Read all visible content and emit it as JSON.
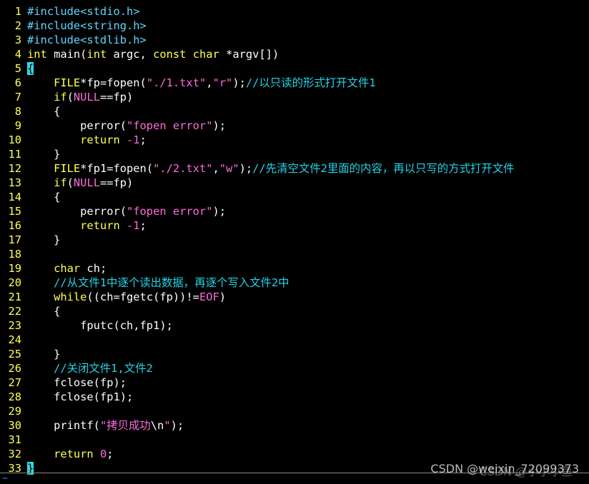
{
  "editor": {
    "lines": [
      {
        "n": "1",
        "parts": [
          [
            "pre",
            "#include<stdio.h>"
          ]
        ]
      },
      {
        "n": "2",
        "parts": [
          [
            "pre",
            "#include<string.h>"
          ]
        ]
      },
      {
        "n": "3",
        "parts": [
          [
            "pre",
            "#include<stdlib.h>"
          ]
        ]
      },
      {
        "n": "4",
        "parts": [
          [
            "kw",
            "int"
          ],
          [
            "code",
            " main("
          ],
          [
            "kw",
            "int"
          ],
          [
            "code",
            " argc, "
          ],
          [
            "kw",
            "const"
          ],
          [
            "code",
            " "
          ],
          [
            "kw",
            "char"
          ],
          [
            "code",
            " *argv[])"
          ]
        ]
      },
      {
        "n": "5",
        "parts": [
          [
            "brace-hl",
            "{"
          ]
        ]
      },
      {
        "n": "6",
        "parts": [
          [
            "code",
            "    "
          ],
          [
            "kw",
            "FILE"
          ],
          [
            "code",
            "*fp=fopen("
          ],
          [
            "str",
            "\"./1.txt\""
          ],
          [
            "code",
            ","
          ],
          [
            "str",
            "\"r\""
          ],
          [
            "code",
            ");"
          ],
          [
            "cmt",
            "//以只读的形式打开文件1"
          ]
        ]
      },
      {
        "n": "7",
        "parts": [
          [
            "code",
            "    "
          ],
          [
            "kw",
            "if"
          ],
          [
            "code",
            "("
          ],
          [
            "num",
            "NULL"
          ],
          [
            "code",
            "==fp)"
          ]
        ]
      },
      {
        "n": "8",
        "parts": [
          [
            "code",
            "    {"
          ]
        ]
      },
      {
        "n": "9",
        "parts": [
          [
            "code",
            "        perror("
          ],
          [
            "str",
            "\"fopen error\""
          ],
          [
            "code",
            ");"
          ]
        ]
      },
      {
        "n": "10",
        "parts": [
          [
            "code",
            "        "
          ],
          [
            "kw",
            "return"
          ],
          [
            "code",
            " "
          ],
          [
            "num",
            "-1"
          ],
          [
            "code",
            ";"
          ]
        ]
      },
      {
        "n": "11",
        "parts": [
          [
            "code",
            "    }"
          ]
        ]
      },
      {
        "n": "12",
        "parts": [
          [
            "code",
            "    "
          ],
          [
            "kw",
            "FILE"
          ],
          [
            "code",
            "*fp1=fopen("
          ],
          [
            "str",
            "\"./2.txt\""
          ],
          [
            "code",
            ","
          ],
          [
            "str",
            "\"w\""
          ],
          [
            "code",
            ");"
          ],
          [
            "cmt",
            "//先清空文件2里面的内容，再以只写的方式打开文件"
          ]
        ]
      },
      {
        "n": "13",
        "parts": [
          [
            "code",
            "    "
          ],
          [
            "kw",
            "if"
          ],
          [
            "code",
            "("
          ],
          [
            "num",
            "NULL"
          ],
          [
            "code",
            "==fp)"
          ]
        ]
      },
      {
        "n": "14",
        "parts": [
          [
            "code",
            "    {"
          ]
        ]
      },
      {
        "n": "15",
        "parts": [
          [
            "code",
            "        perror("
          ],
          [
            "str",
            "\"fopen error\""
          ],
          [
            "code",
            ");"
          ]
        ]
      },
      {
        "n": "16",
        "parts": [
          [
            "code",
            "        "
          ],
          [
            "kw",
            "return"
          ],
          [
            "code",
            " "
          ],
          [
            "num",
            "-1"
          ],
          [
            "code",
            ";"
          ]
        ]
      },
      {
        "n": "17",
        "parts": [
          [
            "code",
            "    }"
          ]
        ]
      },
      {
        "n": "18",
        "parts": [
          [
            "code",
            ""
          ]
        ]
      },
      {
        "n": "19",
        "parts": [
          [
            "code",
            "    "
          ],
          [
            "kw",
            "char"
          ],
          [
            "code",
            " ch;"
          ]
        ]
      },
      {
        "n": "20",
        "parts": [
          [
            "code",
            "    "
          ],
          [
            "cmt",
            "//从文件1中逐个读出数据，再逐个写入文件2中"
          ]
        ]
      },
      {
        "n": "21",
        "parts": [
          [
            "code",
            "    "
          ],
          [
            "kw",
            "while"
          ],
          [
            "code",
            "((ch=fgetc(fp))!="
          ],
          [
            "num",
            "EOF"
          ],
          [
            "code",
            ")"
          ]
        ]
      },
      {
        "n": "22",
        "parts": [
          [
            "code",
            "    {"
          ]
        ]
      },
      {
        "n": "23",
        "parts": [
          [
            "code",
            "        fputc(ch,fp1);"
          ]
        ]
      },
      {
        "n": "24",
        "parts": [
          [
            "code",
            ""
          ]
        ]
      },
      {
        "n": "25",
        "parts": [
          [
            "code",
            "    }"
          ]
        ]
      },
      {
        "n": "26",
        "parts": [
          [
            "code",
            "    "
          ],
          [
            "cmt",
            "//关闭文件1,文件2"
          ]
        ]
      },
      {
        "n": "27",
        "parts": [
          [
            "code",
            "    fclose(fp);"
          ]
        ]
      },
      {
        "n": "28",
        "parts": [
          [
            "code",
            "    fclose(fp1);"
          ]
        ]
      },
      {
        "n": "29",
        "parts": [
          [
            "code",
            ""
          ]
        ]
      },
      {
        "n": "30",
        "parts": [
          [
            "code",
            "    printf("
          ],
          [
            "str",
            "\"拷贝成功"
          ],
          [
            "code",
            "\\n"
          ],
          [
            "str",
            "\""
          ],
          [
            "code",
            ");"
          ]
        ]
      },
      {
        "n": "31",
        "parts": [
          [
            "code",
            ""
          ]
        ]
      },
      {
        "n": "32",
        "parts": [
          [
            "code",
            "    "
          ],
          [
            "kw",
            "return"
          ],
          [
            "code",
            " "
          ],
          [
            "num",
            "0"
          ],
          [
            "code",
            ";"
          ]
        ]
      },
      {
        "n": "33",
        "parts": [
          [
            "brace-hl",
            "}"
          ]
        ]
      }
    ],
    "tilde": "~"
  },
  "watermark": {
    "text": "CSDN @weixin_72099373",
    "ghost": "CSDN @小小小鱼"
  },
  "colors": {
    "background": "#000000",
    "line_number": "#ffff54",
    "keyword": "#ffff54",
    "string": "#ff6bdb",
    "comment": "#22d3e6",
    "preprocessor": "#5fd7ff",
    "brace_highlight": "#34d8e0"
  }
}
